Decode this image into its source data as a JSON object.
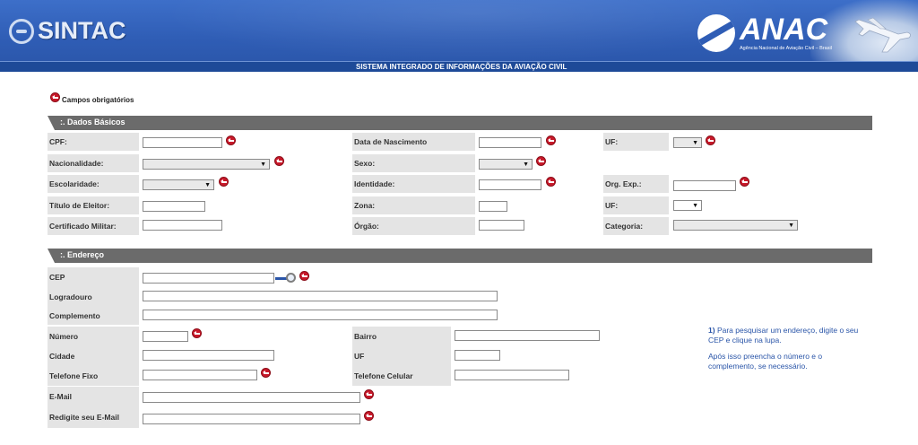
{
  "header": {
    "sintac_logo": "SINTAC",
    "anac_logo": "ANAC",
    "anac_subtitle": "Agência Nacional de Aviação Civil – Brasil",
    "system_title": "SISTEMA INTEGRADO DE INFORMAÇÕES DA AVIAÇÃO CIVIL"
  },
  "legend": {
    "required_text": "Campos obrigatórios"
  },
  "sections": {
    "basic": {
      "title": ":. Dados Básicos",
      "labels": {
        "cpf": "CPF:",
        "nacionalidade": "Nacionalidade:",
        "escolaridade": "Escolaridade:",
        "titulo_eleitor": "Título de Eleitor:",
        "certificado_militar": "Certificado Militar:",
        "data_nascimento": "Data de Nascimento",
        "sexo": "Sexo:",
        "identidade": "Identidade:",
        "zona": "Zona:",
        "orgao": "Órgão:",
        "uf": "UF:",
        "org_exp": "Org. Exp.:",
        "uf2": "UF:",
        "categoria": "Categoria:"
      },
      "values": {
        "cpf": "",
        "nacionalidade": "",
        "escolaridade": "",
        "titulo_eleitor": "",
        "certificado_militar": "",
        "data_nascimento": "",
        "sexo": "",
        "identidade": "",
        "zona": "",
        "orgao": "",
        "uf": "",
        "org_exp": "",
        "uf2": "",
        "categoria": ""
      }
    },
    "address": {
      "title": ":. Endereço",
      "labels": {
        "cep": "CEP",
        "logradouro": "Logradouro",
        "complemento": "Complemento",
        "numero": "Número",
        "cidade": "Cidade",
        "telefone_fixo": "Telefone Fixo",
        "email": "E-Mail",
        "redigite_email": "Redigite seu E-Mail",
        "bairro": "Bairro",
        "uf": "UF",
        "telefone_celular": "Telefone Celular"
      },
      "values": {
        "cep": "",
        "logradouro": "",
        "complemento": "",
        "numero": "",
        "cidade": "",
        "telefone_fixo": "",
        "email": "",
        "redigite_email": "",
        "bairro": "",
        "uf": "",
        "telefone_celular": ""
      },
      "help": {
        "step_number": "1)",
        "step_text": "Para pesquisar um endereço, digite o seu CEP e clique na lupa.",
        "followup": "Após isso preencha o número e o complemento, se necessário."
      }
    }
  },
  "icons": {
    "required": "required-marker-icon",
    "search": "magnifier-search-icon",
    "plane": "airplane-icon"
  },
  "colors": {
    "banner_blue": "#2f5db5",
    "section_bar": "#6b6b6b",
    "label_bg": "#e4e4e4",
    "required_red": "#c8192a",
    "help_text_blue": "#2a55a8"
  }
}
